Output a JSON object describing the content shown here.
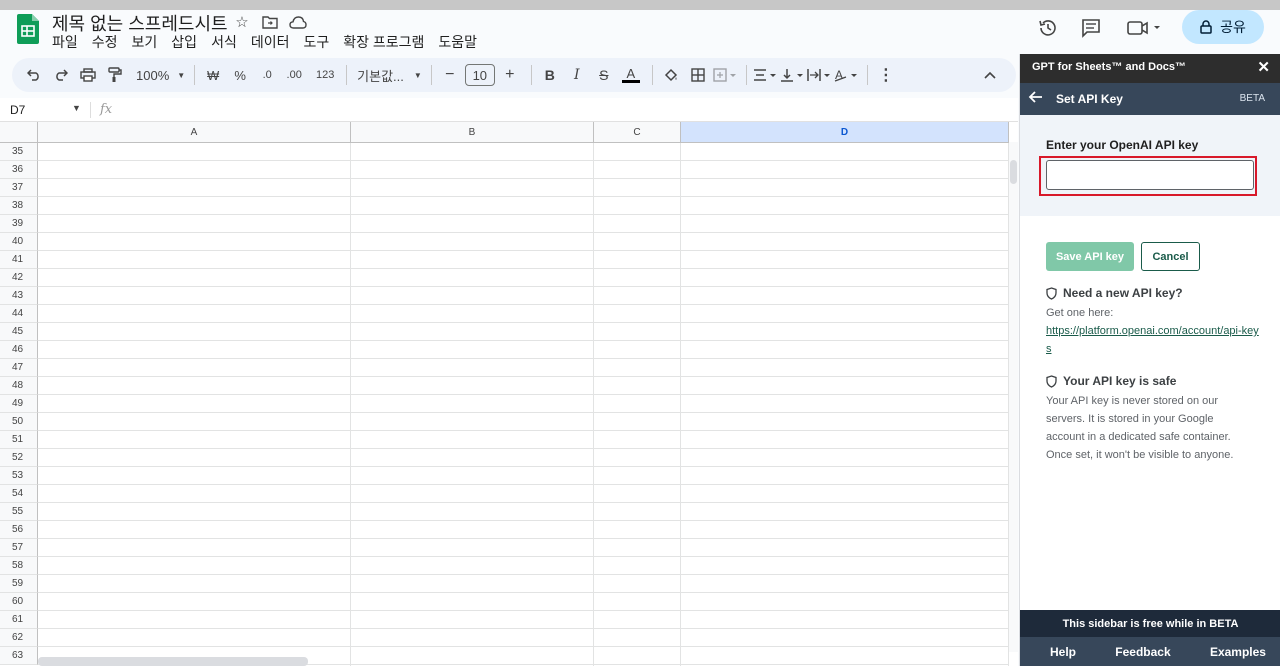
{
  "app": {
    "doc_title": "제목 없는 스프레드시트",
    "menu": [
      "파일",
      "수정",
      "보기",
      "삽입",
      "서식",
      "데이터",
      "도구",
      "확장 프로그램",
      "도움말"
    ],
    "share_label": "공유"
  },
  "toolbar": {
    "zoom": "100%",
    "currency": "₩",
    "percent": "%",
    "dec_decrease": ".0",
    "dec_increase": ".00",
    "number_format": "123",
    "font_name": "기본값...",
    "font_size": "10",
    "minus": "−",
    "plus": "+",
    "bold": "B",
    "italic": "I",
    "strike": "S",
    "text_color": "A"
  },
  "formula_bar": {
    "cell_ref": "D7",
    "fx": "fx"
  },
  "grid": {
    "columns": [
      "A",
      "B",
      "C",
      "D"
    ],
    "selected_column": "D",
    "rows": [
      "35",
      "36",
      "37",
      "38",
      "39",
      "40",
      "41",
      "42",
      "43",
      "44",
      "45",
      "46",
      "47",
      "48",
      "49",
      "50",
      "51",
      "52",
      "53",
      "54",
      "55",
      "56",
      "57",
      "58",
      "59",
      "60",
      "61",
      "62",
      "63"
    ]
  },
  "sidebar": {
    "addon_name": "GPT for Sheets™ and Docs™",
    "close": "✕",
    "nav_title": "Set API Key",
    "beta_label": "BETA",
    "key_label": "Enter your OpenAI API key",
    "key_value": "",
    "save_label": "Save API key",
    "cancel_label": "Cancel",
    "need_key_heading": "Need a new API key?",
    "get_one_text": "Get one here:",
    "link_text": "https://platform.openai.com/account/api-keys",
    "safe_heading": "Your API key is safe",
    "safe_text": "Your API key is never stored on our servers. It is stored in your Google account in a dedicated safe container. Once set, it won't be visible to anyone.",
    "free_note": "This sidebar is free while in BETA",
    "footer": {
      "help": "Help",
      "feedback": "Feedback",
      "examples": "Examples"
    }
  },
  "colors": {
    "accent_share": "#c2e7ff",
    "sidebar_dark": "#37475a",
    "highlight_red": "#d8182a",
    "save_green": "#80c8a8",
    "link_green": "#1a5b4a"
  }
}
